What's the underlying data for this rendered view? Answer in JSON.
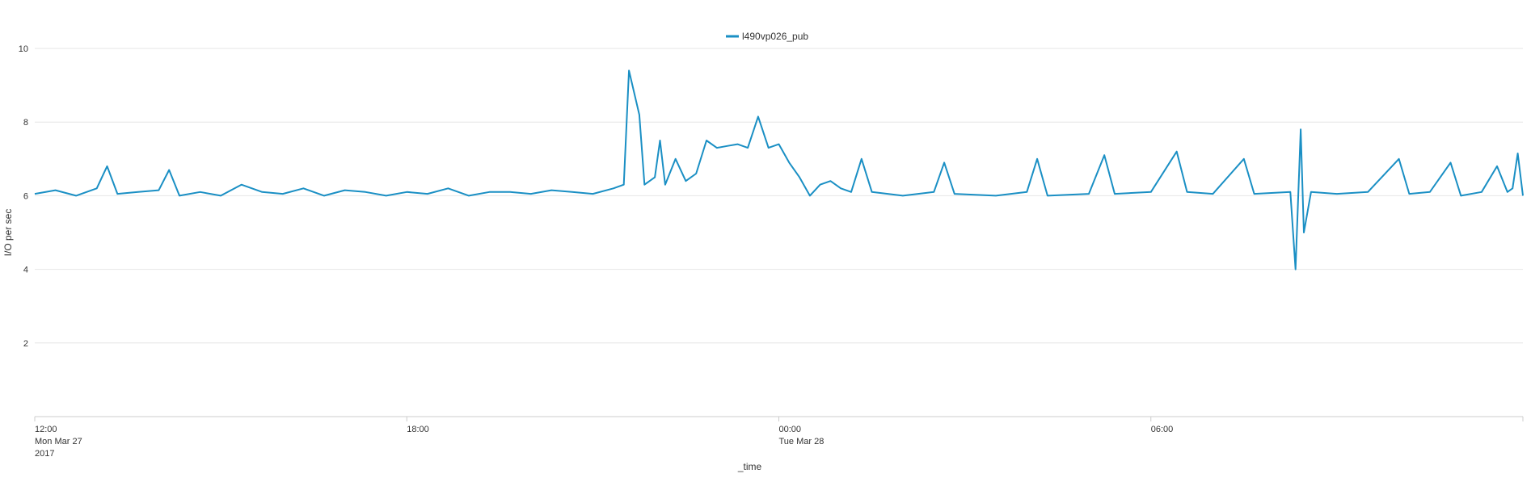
{
  "chart_data": {
    "type": "line",
    "xlabel": "_time",
    "ylabel": "I/O per sec",
    "ylim": [
      0,
      10
    ],
    "y_ticks": [
      "2",
      "4",
      "6",
      "8",
      "10"
    ],
    "x_domain": [
      "2017-03-27T12:00",
      "2017-03-28T12:00"
    ],
    "x_ticks": [
      {
        "time": "2017-03-27T12:00",
        "lines": [
          "12:00",
          "Mon Mar 27",
          "2017"
        ]
      },
      {
        "time": "2017-03-27T18:00",
        "lines": [
          "18:00"
        ]
      },
      {
        "time": "2017-03-28T00:00",
        "lines": [
          "00:00",
          "Tue Mar 28"
        ]
      },
      {
        "time": "2017-03-28T06:00",
        "lines": [
          "06:00"
        ]
      }
    ],
    "grid": true,
    "legend_position": "top-center",
    "series": [
      {
        "name": "l490vp026_pub",
        "color": "#1a8fc4",
        "points": [
          [
            "2017-03-27T12:00",
            6.05
          ],
          [
            "2017-03-27T12:20",
            6.15
          ],
          [
            "2017-03-27T12:40",
            6.0
          ],
          [
            "2017-03-27T13:00",
            6.2
          ],
          [
            "2017-03-27T13:10",
            6.8
          ],
          [
            "2017-03-27T13:20",
            6.05
          ],
          [
            "2017-03-27T13:40",
            6.1
          ],
          [
            "2017-03-27T14:00",
            6.15
          ],
          [
            "2017-03-27T14:10",
            6.7
          ],
          [
            "2017-03-27T14:20",
            6.0
          ],
          [
            "2017-03-27T14:40",
            6.1
          ],
          [
            "2017-03-27T15:00",
            6.0
          ],
          [
            "2017-03-27T15:20",
            6.3
          ],
          [
            "2017-03-27T15:40",
            6.1
          ],
          [
            "2017-03-27T16:00",
            6.05
          ],
          [
            "2017-03-27T16:20",
            6.2
          ],
          [
            "2017-03-27T16:40",
            6.0
          ],
          [
            "2017-03-27T17:00",
            6.15
          ],
          [
            "2017-03-27T17:20",
            6.1
          ],
          [
            "2017-03-27T17:40",
            6.0
          ],
          [
            "2017-03-27T18:00",
            6.1
          ],
          [
            "2017-03-27T18:20",
            6.05
          ],
          [
            "2017-03-27T18:40",
            6.2
          ],
          [
            "2017-03-27T19:00",
            6.0
          ],
          [
            "2017-03-27T19:20",
            6.1
          ],
          [
            "2017-03-27T19:40",
            6.1
          ],
          [
            "2017-03-27T20:00",
            6.05
          ],
          [
            "2017-03-27T20:20",
            6.15
          ],
          [
            "2017-03-27T20:40",
            6.1
          ],
          [
            "2017-03-27T21:00",
            6.05
          ],
          [
            "2017-03-27T21:20",
            6.2
          ],
          [
            "2017-03-27T21:30",
            6.3
          ],
          [
            "2017-03-27T21:35",
            9.4
          ],
          [
            "2017-03-27T21:45",
            8.2
          ],
          [
            "2017-03-27T21:50",
            6.3
          ],
          [
            "2017-03-27T22:00",
            6.5
          ],
          [
            "2017-03-27T22:05",
            7.5
          ],
          [
            "2017-03-27T22:10",
            6.3
          ],
          [
            "2017-03-27T22:20",
            7.0
          ],
          [
            "2017-03-27T22:30",
            6.4
          ],
          [
            "2017-03-27T22:40",
            6.6
          ],
          [
            "2017-03-27T22:50",
            7.5
          ],
          [
            "2017-03-27T23:00",
            7.3
          ],
          [
            "2017-03-27T23:10",
            7.35
          ],
          [
            "2017-03-27T23:20",
            7.4
          ],
          [
            "2017-03-27T23:30",
            7.3
          ],
          [
            "2017-03-27T23:40",
            8.15
          ],
          [
            "2017-03-27T23:50",
            7.3
          ],
          [
            "2017-03-28T00:00",
            7.4
          ],
          [
            "2017-03-28T00:10",
            6.9
          ],
          [
            "2017-03-28T00:20",
            6.5
          ],
          [
            "2017-03-28T00:30",
            6.0
          ],
          [
            "2017-03-28T00:40",
            6.3
          ],
          [
            "2017-03-28T00:50",
            6.4
          ],
          [
            "2017-03-28T01:00",
            6.2
          ],
          [
            "2017-03-28T01:10",
            6.1
          ],
          [
            "2017-03-28T01:20",
            7.0
          ],
          [
            "2017-03-28T01:30",
            6.1
          ],
          [
            "2017-03-28T02:00",
            6.0
          ],
          [
            "2017-03-28T02:30",
            6.1
          ],
          [
            "2017-03-28T02:40",
            6.9
          ],
          [
            "2017-03-28T02:50",
            6.05
          ],
          [
            "2017-03-28T03:30",
            6.0
          ],
          [
            "2017-03-28T04:00",
            6.1
          ],
          [
            "2017-03-28T04:10",
            7.0
          ],
          [
            "2017-03-28T04:20",
            6.0
          ],
          [
            "2017-03-28T05:00",
            6.05
          ],
          [
            "2017-03-28T05:15",
            7.1
          ],
          [
            "2017-03-28T05:25",
            6.05
          ],
          [
            "2017-03-28T06:00",
            6.1
          ],
          [
            "2017-03-28T06:25",
            7.2
          ],
          [
            "2017-03-28T06:35",
            6.1
          ],
          [
            "2017-03-28T07:00",
            6.05
          ],
          [
            "2017-03-28T07:30",
            7.0
          ],
          [
            "2017-03-28T07:40",
            6.05
          ],
          [
            "2017-03-28T08:15",
            6.1
          ],
          [
            "2017-03-28T08:20",
            4.0
          ],
          [
            "2017-03-28T08:25",
            7.8
          ],
          [
            "2017-03-28T08:28",
            5.0
          ],
          [
            "2017-03-28T08:35",
            6.1
          ],
          [
            "2017-03-28T09:00",
            6.05
          ],
          [
            "2017-03-28T09:30",
            6.1
          ],
          [
            "2017-03-28T10:00",
            7.0
          ],
          [
            "2017-03-28T10:10",
            6.05
          ],
          [
            "2017-03-28T10:30",
            6.1
          ],
          [
            "2017-03-28T10:50",
            6.9
          ],
          [
            "2017-03-28T11:00",
            6.0
          ],
          [
            "2017-03-28T11:20",
            6.1
          ],
          [
            "2017-03-28T11:35",
            6.8
          ],
          [
            "2017-03-28T11:45",
            6.1
          ],
          [
            "2017-03-28T11:50",
            6.2
          ],
          [
            "2017-03-28T11:55",
            7.15
          ],
          [
            "2017-03-28T12:00",
            6.0
          ]
        ]
      }
    ]
  }
}
